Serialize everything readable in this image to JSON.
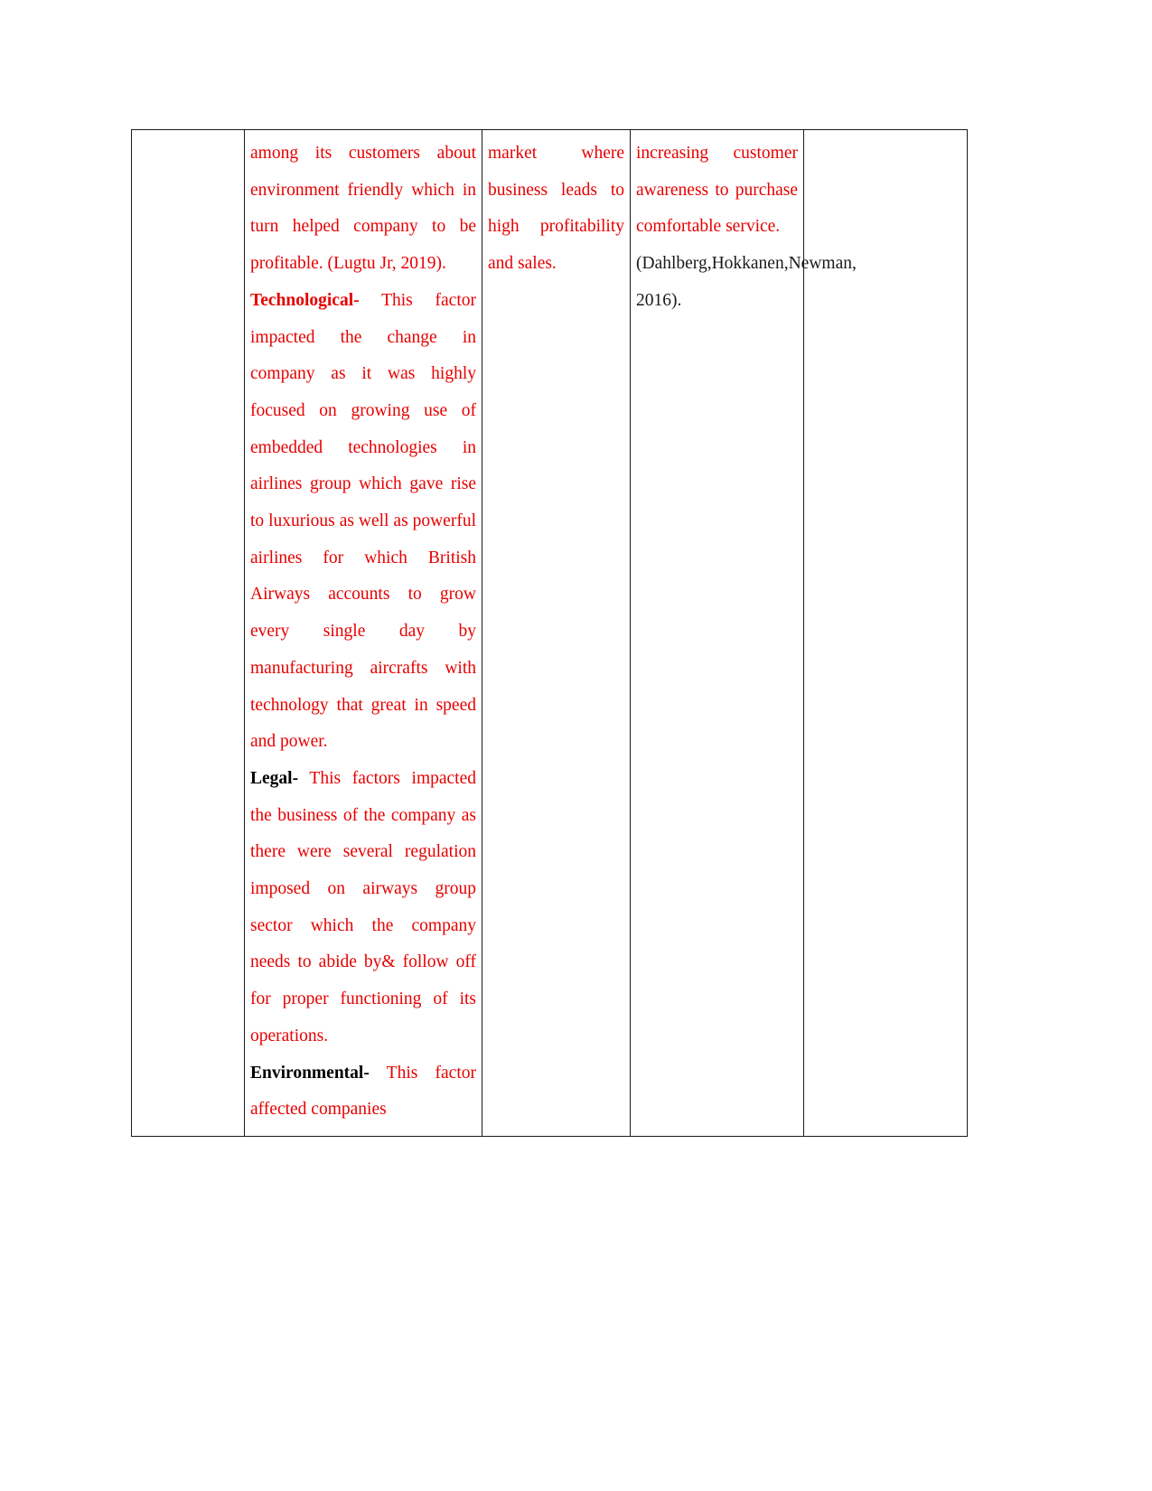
{
  "document": {
    "type": "table-continuation",
    "page_background": "#ffffff",
    "text_color_primary": "#e60000",
    "text_color_secondary": "#1a1a1a",
    "border_color": "#1a1a1a"
  },
  "table": {
    "name": "pestle-analysis-table-continued",
    "column_count": 5,
    "columns": [
      {
        "key": "col_a",
        "label": ""
      },
      {
        "key": "col_b",
        "label": ""
      },
      {
        "key": "col_c",
        "label": ""
      },
      {
        "key": "col_d",
        "label": ""
      },
      {
        "key": "col_e",
        "label": ""
      }
    ],
    "rows": [
      {
        "cells": {
          "col_a": {
            "paragraphs": []
          },
          "col_b": {
            "paragraphs": [
              {
                "lead": null,
                "lead_style": null,
                "body": "among its customers about environment friendly which in turn helped company to be profitable. (Lugtu Jr, 2019)."
              },
              {
                "lead": "Technological-",
                "lead_style": "bold-red",
                "body": " This factor impacted the change in company as it was highly focused on growing use of embedded technologies in airlines group which gave rise to luxurious as well as powerful airlines for which British Airways accounts to grow every single day by manufacturing aircrafts with technology that great in speed and power."
              },
              {
                "lead": "Legal-",
                "lead_style": "bold-black",
                "body": " This factors impacted the business of the company as there were several regulation imposed on airways group sector which the company needs to abide by& follow off for proper functioning of its operations."
              },
              {
                "lead": "Environmental-",
                "lead_style": "bold-black",
                "body": " This factor affected companies"
              }
            ]
          },
          "col_c": {
            "paragraphs": [
              {
                "lead": null,
                "lead_style": null,
                "body": "market where business leads to high profitability and sales."
              }
            ]
          },
          "col_d": {
            "paragraphs": [
              {
                "lead": null,
                "lead_style": null,
                "body": "increasing customer awareness to purchase comfortable service."
              },
              {
                "lead": null,
                "lead_style": "black",
                "body": "(Dahlberg,Hokkanen,Newman, 2016)."
              }
            ]
          },
          "col_e": {
            "paragraphs": []
          }
        }
      }
    ]
  },
  "content": {
    "col_b_para_1": "among its customers about environment friendly which in turn helped company to be profitable. (Lugtu Jr, 2019).",
    "col_b_para_2_lead": "Technological-",
    "col_b_para_2_body": " This factor impacted the change in company as it was highly focused on growing use of embedded technologies in airlines group which gave rise to luxurious as well as powerful airlines for which British Airways accounts to grow every single day by manufacturing aircrafts with technology that great in speed and power.",
    "col_b_para_3_lead": "Legal-",
    "col_b_para_3_body": " This factors impacted the business of the company as there were several regulation imposed on airways group sector which the company needs to abide by& follow off for proper functioning of its operations.",
    "col_b_para_4_lead": "Environmental-",
    "col_b_para_4_body": " This factor affected companies",
    "col_c_para_1": "market where business leads to high profitability and sales.",
    "col_d_para_1": "increasing customer awareness to purchase comfortable service.",
    "col_d_para_2": "(Dahlberg,Hokkanen,Newman, 2016)."
  }
}
